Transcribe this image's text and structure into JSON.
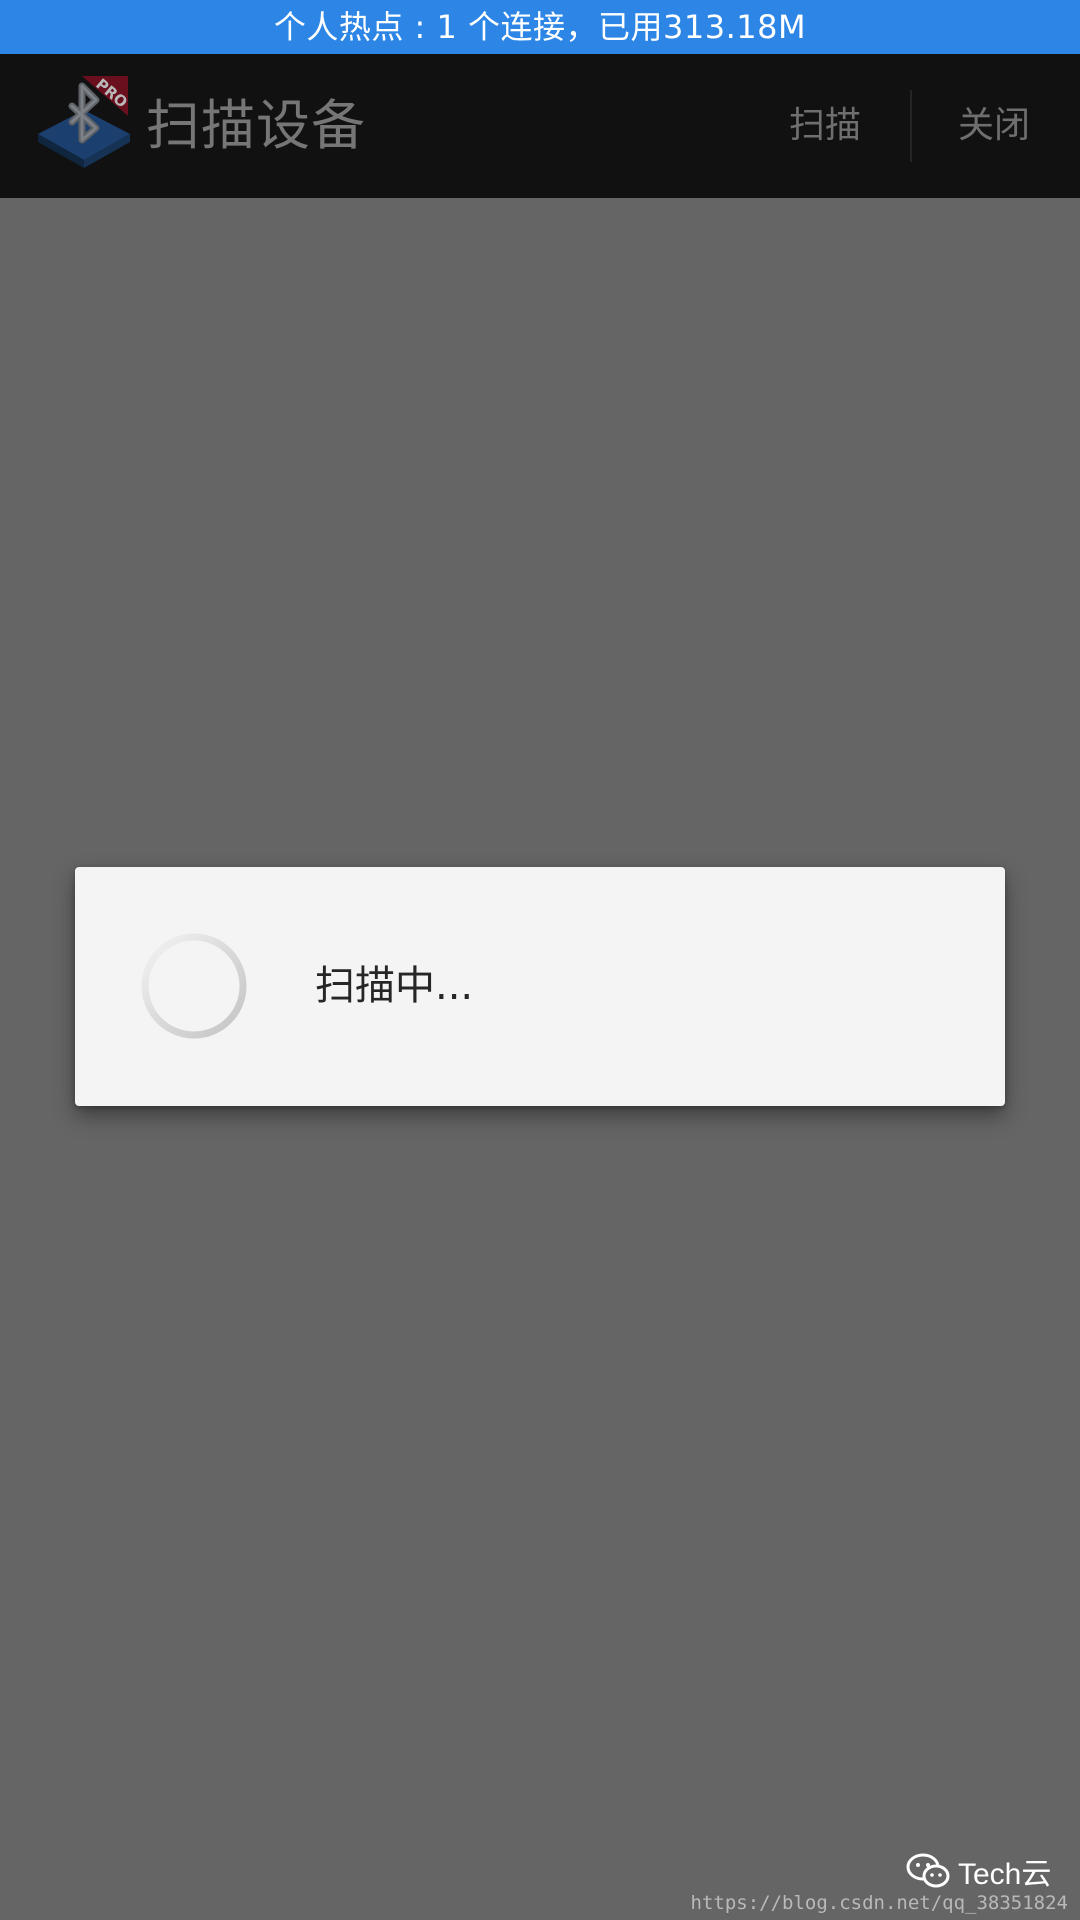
{
  "status_bar": {
    "text": "个人热点 : 1 个连接，已用313.18M",
    "background": "#2d86e6"
  },
  "app_bar": {
    "logo_icon": "bluetooth-pro-logo-icon",
    "logo_badge": "PRO",
    "title": "扫描设备",
    "actions": [
      {
        "label": "扫描"
      },
      {
        "label": "关闭"
      }
    ]
  },
  "dialog": {
    "spinner_icon": "loading-spinner-icon",
    "message": "扫描中..."
  },
  "watermark": {
    "brand_icon": "wechat-icon",
    "brand": "Tech云",
    "url": "https://blog.csdn.net/qq_38351824"
  },
  "colors": {
    "overlay": "#656565",
    "dialog": "#f4f4f4",
    "app_bar": "#111111"
  }
}
